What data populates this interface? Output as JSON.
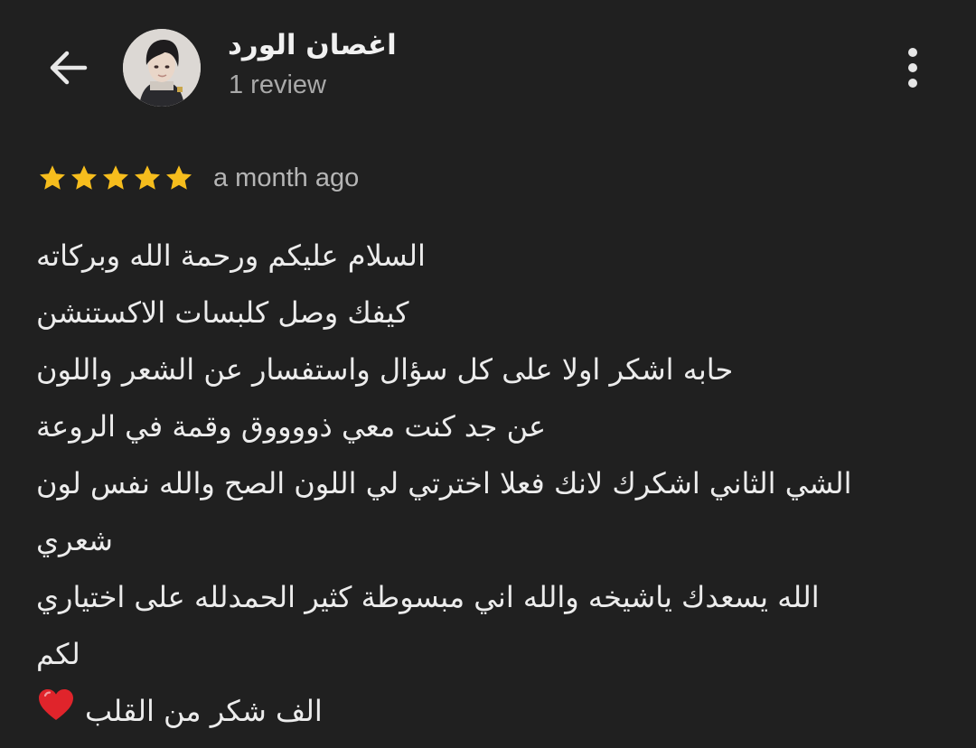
{
  "header": {
    "back_icon": "arrow-left-icon",
    "user_name": "اغصان الورد",
    "review_count": "1 review",
    "more_icon": "more-vertical-icon"
  },
  "review": {
    "rating": 5,
    "rating_max": 5,
    "star_color": "#f6bd1d",
    "time_ago": "a month ago",
    "lines": [
      "السلام عليكم ورحمة الله وبركاته",
      "كيفك وصل كلبسات الاكستنشن",
      "حابه اشكر اولا على كل سؤال واستفسار عن الشعر واللون",
      "عن جد كنت معي ذووووق وقمة في الروعة",
      "الشي الثاني اشكرك لانك فعلا اخترتي لي اللون الصح والله نفس لون",
      "شعري",
      "الله يسعدك ياشيخه والله اني مبسوطة كثير الحمدلله على اختياري",
      "لكم",
      "الف شكر من القلب"
    ],
    "end_emoji": "heart-icon",
    "heart_color": "#e0242b"
  }
}
